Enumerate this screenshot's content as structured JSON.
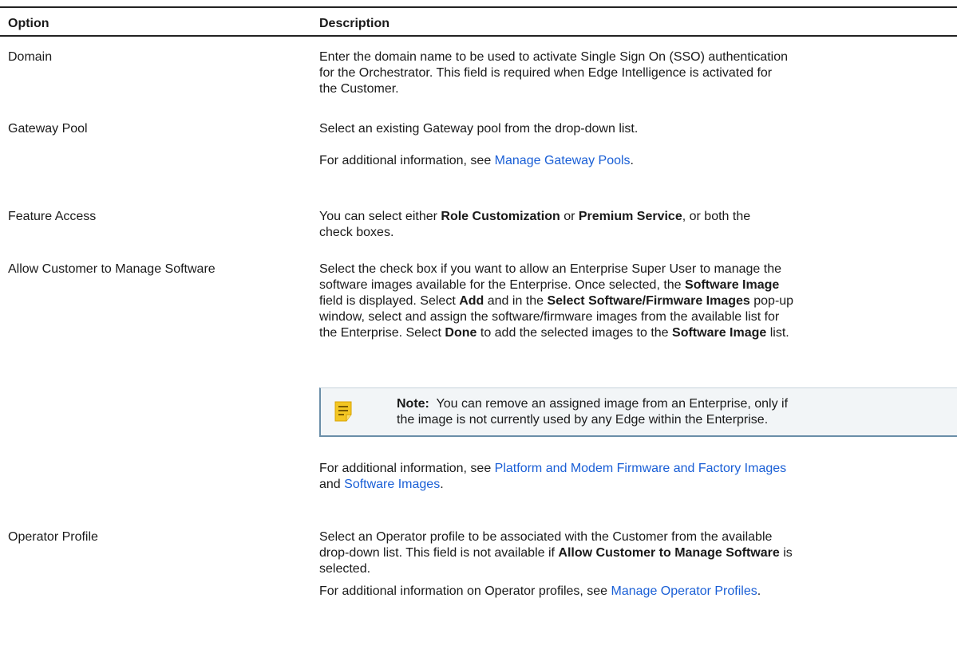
{
  "header": {
    "option": "Option",
    "description": "Description"
  },
  "rows": {
    "domain": {
      "option": "Domain",
      "line1": "Enter the domain name to be used to activate Single Sign On (SSO) authentication",
      "line2": "for the Orchestrator. This field is required when Edge Intelligence is activated for",
      "line3": "the Customer."
    },
    "gateway_pool": {
      "option": "Gateway Pool",
      "line1": "Select an existing Gateway pool from the drop-down list.",
      "info_prefix": "For additional information, see ",
      "info_link": "Manage Gateway Pools",
      "info_suffix": "."
    },
    "feature_access": {
      "option": "Feature Access",
      "l1_a": "You can select either ",
      "l1_b": "Role Customization",
      "l1_c": " or ",
      "l1_d": "Premium Service",
      "l1_e": ", or both the",
      "line2": "check boxes."
    },
    "manage_software": {
      "option": "Allow Customer to Manage Software",
      "line1": "Select the check box if you want to allow an Enterprise Super User to manage the",
      "l2_a": "software images available for the Enterprise. Once selected, the ",
      "l2_b": "Software Image",
      "l3_a": "field is displayed. Select ",
      "l3_b": "Add",
      "l3_c": " and in the ",
      "l3_d": "Select Software/Firmware Images",
      "l3_e": " pop-up",
      "line4": "window, select and assign the software/firmware images from the available list for",
      "l5_a": "the Enterprise. Select ",
      "l5_b": "Done",
      "l5_c": " to add the selected images to the ",
      "l5_d": "Software Image",
      "l5_e": " list.",
      "note_label": "Note:",
      "note_line1": "  You can remove an assigned image from an Enterprise, only if",
      "note_line2": "the image is not currently used by any Edge within the Enterprise.",
      "info_prefix": "For additional information, see ",
      "info_link1": "Platform and Modem Firmware and Factory Images",
      "info_and": "and ",
      "info_link2": "Software Images",
      "info_suffix": "."
    },
    "operator_profile": {
      "option": "Operator Profile",
      "line1": "Select an Operator profile to be associated with the Customer from the available",
      "l2_a": "drop-down list. This field is not available if ",
      "l2_b": "Allow Customer to Manage Software",
      "l2_c": " is",
      "line3": "selected.",
      "info_prefix": "For additional information on Operator profiles, see ",
      "info_link": "Manage Operator Profiles",
      "info_suffix": "."
    }
  },
  "icons": {
    "note": "note-icon"
  },
  "colors": {
    "link": "#1a5fd6",
    "note_bg": "#f2f5f7",
    "note_border": "#6a8ea8",
    "note_icon": "#f3c623"
  }
}
